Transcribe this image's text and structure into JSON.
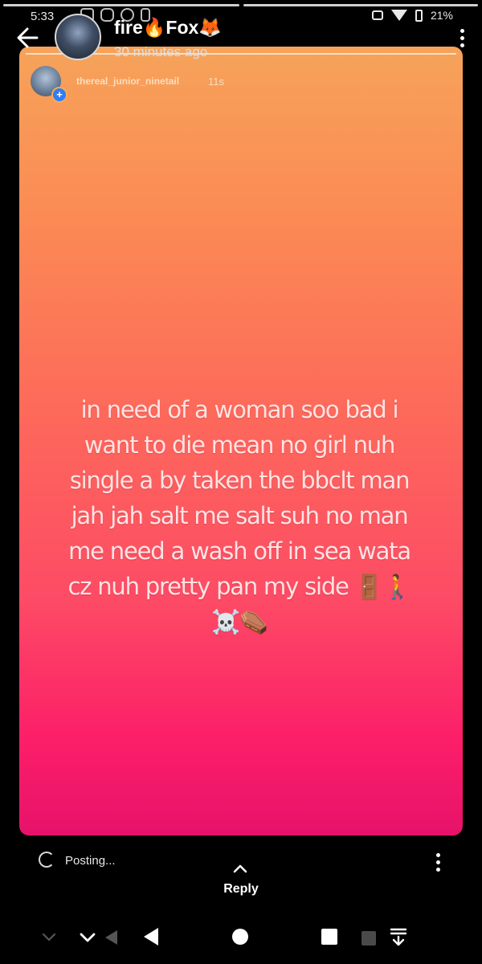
{
  "status_bar": {
    "time": "5:33",
    "battery_percent": "21%"
  },
  "story_progress": {
    "segments": 2,
    "active_index": 1
  },
  "header": {
    "username": "fire🔥Fox🦊",
    "posted_time": "30 minutes ago"
  },
  "shared_post": {
    "username": "thereal_junior_ninetail",
    "time_ago": "11s",
    "caption": "in need of a woman soo bad i want to die mean no girl nuh single a by taken the bbclt man jah jah salt me salt suh no man me need a wash off in sea wata cz nuh pretty pan my side 🚪🚶☠️⚰️"
  },
  "footer": {
    "posting_label": "Posting...",
    "reply_label": "Reply"
  },
  "colors": {
    "gradient_top": "#f6a35a",
    "gradient_bottom": "#e6126a",
    "background": "#000000"
  },
  "icons": [
    "back-arrow-icon",
    "more-vertical-icon",
    "spinner-icon",
    "chevron-up-icon",
    "nav-back-icon",
    "nav-home-icon",
    "nav-recents-icon"
  ]
}
